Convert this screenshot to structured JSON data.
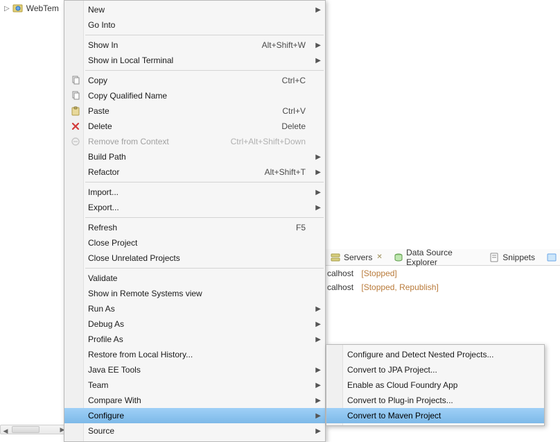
{
  "tree": {
    "project_name": "WebTem"
  },
  "menu": {
    "items": [
      {
        "label": "New",
        "arrow": true
      },
      {
        "label": "Go Into"
      },
      {
        "sep": true
      },
      {
        "label": "Show In",
        "shortcut": "Alt+Shift+W",
        "arrow": true
      },
      {
        "label": "Show in Local Terminal",
        "arrow": true
      },
      {
        "sep": true
      },
      {
        "label": "Copy",
        "shortcut": "Ctrl+C",
        "icon": "copy"
      },
      {
        "label": "Copy Qualified Name",
        "icon": "copy"
      },
      {
        "label": "Paste",
        "shortcut": "Ctrl+V",
        "icon": "paste"
      },
      {
        "label": "Delete",
        "shortcut": "Delete",
        "icon": "delete"
      },
      {
        "label": "Remove from Context",
        "shortcut": "Ctrl+Alt+Shift+Down",
        "icon": "remove",
        "disabled": true
      },
      {
        "label": "Build Path",
        "arrow": true
      },
      {
        "label": "Refactor",
        "shortcut": "Alt+Shift+T",
        "arrow": true
      },
      {
        "sep": true
      },
      {
        "label": "Import...",
        "arrow": true
      },
      {
        "label": "Export...",
        "arrow": true
      },
      {
        "sep": true
      },
      {
        "label": "Refresh",
        "shortcut": "F5"
      },
      {
        "label": "Close Project"
      },
      {
        "label": "Close Unrelated Projects"
      },
      {
        "sep": true
      },
      {
        "label": "Validate"
      },
      {
        "label": "Show in Remote Systems view"
      },
      {
        "label": "Run As",
        "arrow": true
      },
      {
        "label": "Debug As",
        "arrow": true
      },
      {
        "label": "Profile As",
        "arrow": true
      },
      {
        "label": "Restore from Local History..."
      },
      {
        "label": "Java EE Tools",
        "arrow": true
      },
      {
        "label": "Team",
        "arrow": true
      },
      {
        "label": "Compare With",
        "arrow": true
      },
      {
        "label": "Configure",
        "arrow": true,
        "highlight": true
      },
      {
        "label": "Source",
        "arrow": true
      }
    ]
  },
  "submenu": {
    "items": [
      {
        "label": "Configure and Detect Nested Projects..."
      },
      {
        "label": "Convert to JPA Project..."
      },
      {
        "label": "Enable as Cloud Foundry App"
      },
      {
        "label": "Convert to Plug-in Projects..."
      },
      {
        "label": "Convert to Maven Project",
        "highlight": true
      }
    ]
  },
  "tabs": {
    "servers": "Servers",
    "data_explorer": "Data Source Explorer",
    "snippets": "Snippets"
  },
  "servers": {
    "rows": [
      {
        "host": "calhost",
        "status": "[Stopped]"
      },
      {
        "host": "calhost",
        "status": "[Stopped, Republish]"
      }
    ]
  }
}
